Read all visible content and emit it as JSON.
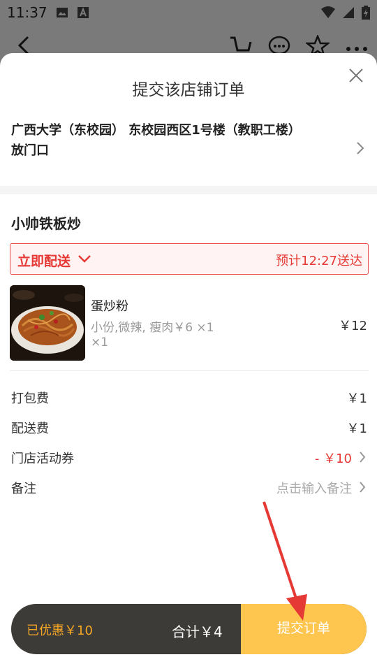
{
  "status_bar": {
    "time": "11:37"
  },
  "sheet": {
    "title": "提交该店铺订单",
    "address_line1": "广西大学（东校园） 东校园西区1号楼（教职工楼）",
    "address_line2": "放门口"
  },
  "shop": {
    "name": "小帅铁板炒",
    "delivery_mode": "立即配送",
    "eta": "预计12:27送达"
  },
  "item": {
    "name": "蛋炒粉",
    "spec": "小份,微辣, 瘦肉￥6 ×1",
    "qty": "×1",
    "price": "￥12"
  },
  "fees": [
    {
      "label": "打包费",
      "value": "￥1"
    },
    {
      "label": "配送费",
      "value": "￥1"
    },
    {
      "label": "门店活动券",
      "value": "- ￥10"
    },
    {
      "label": "备注",
      "value": "点击输入备注"
    }
  ],
  "bottom": {
    "discount": "已优惠￥10",
    "total": "合计￥4",
    "submit": "提交订单"
  },
  "colors": {
    "accent_red": "#e53935",
    "submit_yellow": "#fec54f",
    "bar_dark": "#3d3b38",
    "discount_orange": "#f5a623"
  }
}
